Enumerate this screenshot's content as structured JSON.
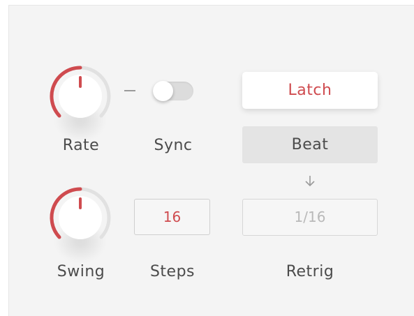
{
  "controls": {
    "rate": {
      "label": "Rate"
    },
    "sync": {
      "label": "Sync",
      "state": "off"
    },
    "swing": {
      "label": "Swing"
    },
    "steps": {
      "label": "Steps",
      "value": "16"
    },
    "retrig": {
      "label": "Retrig",
      "value": "1/16"
    },
    "latch": {
      "label": "Latch"
    },
    "beat": {
      "label": "Beat"
    }
  },
  "icons": {
    "arrow": "arrow-down-icon"
  },
  "colors": {
    "accent": "#cf4b4f",
    "panel": "#f4f4f4",
    "text": "#4b4b4b",
    "beat_button": "#e4e4e4"
  }
}
